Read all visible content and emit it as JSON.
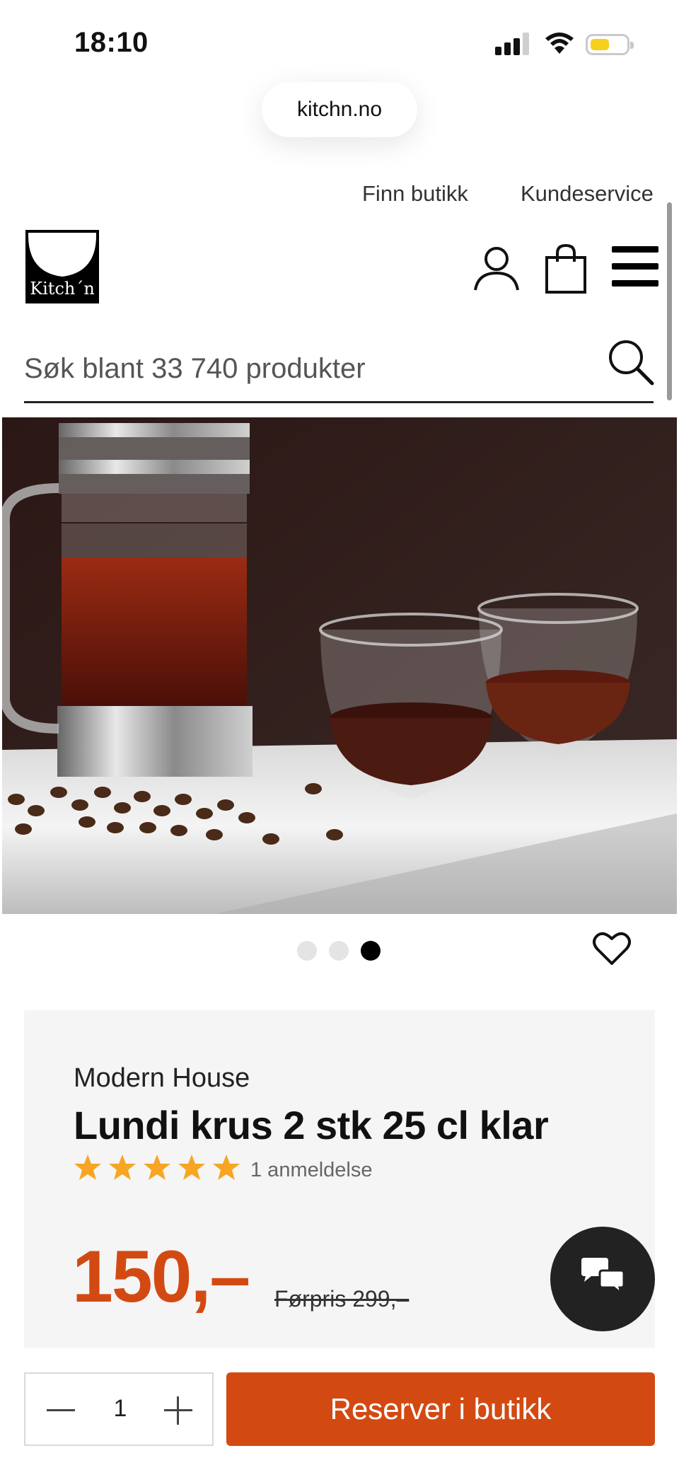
{
  "status_bar": {
    "time": "18:10"
  },
  "browser": {
    "url": "kitchn.no"
  },
  "top_links": {
    "find_store": "Finn butikk",
    "customer_service": "Kundeservice"
  },
  "header": {
    "logo_text": "Kitch´n"
  },
  "search": {
    "placeholder": "Søk blant 33 740 produkter",
    "value": ""
  },
  "carousel": {
    "total": 3,
    "active_index": 2
  },
  "product": {
    "brand": "Modern House",
    "title": "Lundi krus 2 stk 25 cl klar",
    "rating": 5,
    "rating_max": 5,
    "reviews_label": "1 anmeldelse",
    "price": "150,–",
    "old_price": "Førpris 299,–"
  },
  "purchase": {
    "quantity": "1",
    "reserve_label": "Reserver i butikk"
  },
  "colors": {
    "accent": "#d24a12",
    "star": "#f6a623",
    "chat_bg": "#222222"
  },
  "icons": [
    "signal-icon",
    "wifi-icon",
    "battery-icon",
    "user-icon",
    "bag-icon",
    "menu-icon",
    "search-icon",
    "heart-icon",
    "star-icon",
    "chat-icon",
    "minus-icon",
    "plus-icon"
  ]
}
